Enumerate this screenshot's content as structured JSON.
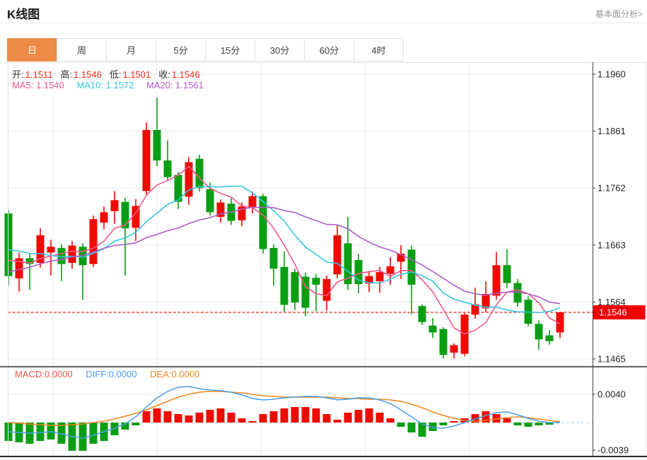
{
  "page": {
    "title": "K线图",
    "fundamental_link": "基本面分析>"
  },
  "tabs": [
    {
      "label": "日",
      "active": true
    },
    {
      "label": "周",
      "active": false
    },
    {
      "label": "月",
      "active": false
    },
    {
      "label": "5分",
      "active": false
    },
    {
      "label": "15分",
      "active": false
    },
    {
      "label": "30分",
      "active": false
    },
    {
      "label": "60分",
      "active": false
    },
    {
      "label": "4时",
      "active": false
    }
  ],
  "kline_legend": {
    "open_label": "开:",
    "open_value": "1.1511",
    "high_label": "高:",
    "high_value": "1.1546",
    "low_label": "低:",
    "low_value": "1.1501",
    "close_label": "收:",
    "close_value": "1.1546",
    "ma5_label": "MA5:",
    "ma5_value": "1.1540",
    "ma10_label": "MA10:",
    "ma10_value": "1.1572",
    "ma20_label": "MA20:",
    "ma20_value": "1.1561"
  },
  "macd_legend": {
    "macd_label": "MACD:",
    "macd_value": "0.0000",
    "diff_label": "DIFF:",
    "diff_value": "0.0000",
    "dea_label": "DEA:",
    "dea_value": "0.0000"
  },
  "colors": {
    "candle_up_red": "#ee0b00",
    "candle_down_green": "#0a9e14",
    "ma5": "#f2568a",
    "ma10": "#36c6e0",
    "ma20": "#b25bc8",
    "diff_line": "#4a9ce8",
    "dea_line": "#f0861c",
    "macd_text": "#f05452",
    "value_red": "#fa291c",
    "tab_active_bg": "#ed8a45",
    "badge_bg": "#ee0000",
    "grid": "#e8eef4",
    "border_light": "#e4e4e4",
    "border_dark": "#2b2b2b",
    "zero_dotted": "#aed9ec",
    "price_dashed": "#ff2211"
  },
  "chart_data": {
    "type": "candlestick+macd",
    "price_axis": {
      "tick_labels": [
        "1.1960",
        "1.1861",
        "1.1762",
        "1.1663",
        "1.1564",
        "1.1465"
      ],
      "ylim": [
        1.1465,
        1.196
      ],
      "current_price_label": "1.1546",
      "current_price": 1.1546,
      "grid": true
    },
    "macd_axis": {
      "tick_labels": [
        "0.0040",
        "-0.0039"
      ],
      "ylim": [
        -0.0039,
        0.004
      ]
    },
    "last_candle_ohlc": {
      "open": 1.1511,
      "high": 1.1546,
      "low": 1.1501,
      "close": 1.1546
    },
    "candles_ohlc": [
      [
        1.1718,
        1.1724,
        1.1593,
        1.1609
      ],
      [
        1.1605,
        1.165,
        1.1582,
        1.164
      ],
      [
        1.164,
        1.1648,
        1.1585,
        1.163
      ],
      [
        1.1632,
        1.1692,
        1.1624,
        1.168
      ],
      [
        1.165,
        1.1672,
        1.161,
        1.166
      ],
      [
        1.1658,
        1.1664,
        1.16,
        1.163
      ],
      [
        1.1632,
        1.167,
        1.1622,
        1.1662
      ],
      [
        1.166,
        1.1666,
        1.1568,
        1.1628
      ],
      [
        1.163,
        1.1714,
        1.1625,
        1.1708
      ],
      [
        1.1702,
        1.173,
        1.169,
        1.172
      ],
      [
        1.1722,
        1.1757,
        1.17,
        1.1741
      ],
      [
        1.1738,
        1.1745,
        1.161,
        1.1692
      ],
      [
        1.1693,
        1.1743,
        1.167,
        1.1731
      ],
      [
        1.1757,
        1.1876,
        1.175,
        1.1863
      ],
      [
        1.1863,
        1.1919,
        1.18,
        1.181
      ],
      [
        1.181,
        1.1845,
        1.1776,
        1.1781
      ],
      [
        1.1785,
        1.179,
        1.1726,
        1.1738
      ],
      [
        1.1747,
        1.1816,
        1.1733,
        1.1807
      ],
      [
        1.1813,
        1.182,
        1.1756,
        1.1762
      ],
      [
        1.176,
        1.1772,
        1.1714,
        1.172
      ],
      [
        1.1712,
        1.1742,
        1.1702,
        1.1737
      ],
      [
        1.1735,
        1.1744,
        1.1698,
        1.1705
      ],
      [
        1.1706,
        1.1737,
        1.1696,
        1.173
      ],
      [
        1.1728,
        1.1756,
        1.1718,
        1.1748
      ],
      [
        1.1748,
        1.1752,
        1.1648,
        1.1656
      ],
      [
        1.1658,
        1.1664,
        1.1592,
        1.1622
      ],
      [
        1.1625,
        1.1652,
        1.1547,
        1.1559
      ],
      [
        1.1616,
        1.1622,
        1.155,
        1.1563
      ],
      [
        1.1608,
        1.1615,
        1.1539,
        1.1554
      ],
      [
        1.1606,
        1.1612,
        1.1548,
        1.1594
      ],
      [
        1.1566,
        1.161,
        1.1549,
        1.1604
      ],
      [
        1.1612,
        1.1697,
        1.1605,
        1.168
      ],
      [
        1.1666,
        1.1712,
        1.1585,
        1.1595
      ],
      [
        1.1637,
        1.1648,
        1.1579,
        1.1595
      ],
      [
        1.1596,
        1.1618,
        1.1581,
        1.1609
      ],
      [
        1.16,
        1.1625,
        1.158,
        1.1616
      ],
      [
        1.1613,
        1.1642,
        1.1594,
        1.1626
      ],
      [
        1.1634,
        1.1663,
        1.1604,
        1.1648
      ],
      [
        1.1655,
        1.1662,
        1.1543,
        1.1594
      ],
      [
        1.1557,
        1.156,
        1.1524,
        1.1529
      ],
      [
        1.1523,
        1.1536,
        1.1501,
        1.1511
      ],
      [
        1.1517,
        1.152,
        1.1466,
        1.1472
      ],
      [
        1.1476,
        1.1492,
        1.1466,
        1.1489
      ],
      [
        1.1474,
        1.1545,
        1.147,
        1.1542
      ],
      [
        1.1542,
        1.1589,
        1.1535,
        1.156
      ],
      [
        1.1553,
        1.16,
        1.1546,
        1.1578
      ],
      [
        1.1575,
        1.1651,
        1.1568,
        1.1628
      ],
      [
        1.1628,
        1.1656,
        1.1588,
        1.1597
      ],
      [
        1.1597,
        1.1604,
        1.1556,
        1.1563
      ],
      [
        1.1568,
        1.1574,
        1.1522,
        1.1526
      ],
      [
        1.1526,
        1.1532,
        1.1481,
        1.1499
      ],
      [
        1.1506,
        1.1515,
        1.149,
        1.1496
      ],
      [
        1.1511,
        1.1546,
        1.1501,
        1.1546
      ]
    ],
    "ma_prior_closes_seed": [
      1.154,
      1.1548,
      1.1555,
      1.156,
      1.1565,
      1.157,
      1.1575,
      1.158,
      1.1585,
      1.1592,
      1.164,
      1.166,
      1.1675,
      1.1682,
      1.1693,
      1.1655,
      1.165,
      1.1645,
      1.1641,
      1.1638
    ],
    "ma_periods": [
      5,
      10,
      20
    ],
    "macd": {
      "bars": [
        -0.0026,
        -0.0028,
        -0.003,
        -0.0026,
        -0.0024,
        -0.003,
        -0.004,
        -0.004,
        -0.003,
        -0.0026,
        -0.0018,
        -0.001,
        -0.0004,
        0.0016,
        0.002,
        0.0016,
        0.0012,
        0.001,
        0.0014,
        0.0018,
        0.002,
        0.0014,
        0.0006,
        0.0002,
        0.0012,
        0.0016,
        0.002,
        0.0022,
        0.0022,
        0.002,
        0.0012,
        0.0004,
        0.0014,
        0.0018,
        0.002,
        0.0014,
        0.0006,
        -0.0006,
        -0.0014,
        -0.002,
        -0.0012,
        -0.0004,
        0.0002,
        0.0006,
        0.0012,
        0.0016,
        0.0012,
        0.0006,
        -0.0004,
        -0.0006,
        -0.0004,
        -0.0003,
        0.0
      ],
      "diff": [
        -0.0013,
        -0.0014,
        -0.0015,
        -0.0014,
        -0.0013,
        -0.0016,
        -0.002,
        -0.0022,
        -0.0018,
        -0.0013,
        -0.0008,
        -0.0002,
        0.0008,
        0.0022,
        0.0035,
        0.0044,
        0.005,
        0.0051,
        0.0048,
        0.0046,
        0.0045,
        0.0043,
        0.0039,
        0.0034,
        0.0032,
        0.0033,
        0.0035,
        0.0036,
        0.0037,
        0.0037,
        0.0035,
        0.0032,
        0.0033,
        0.0035,
        0.0035,
        0.0032,
        0.0027,
        0.0018,
        0.0008,
        -0.0002,
        -0.0007,
        -0.0008,
        -0.0005,
        0.0,
        0.0005,
        0.001,
        0.0014,
        0.0015,
        0.0011,
        0.0006,
        0.0002,
        0.0,
        0.0
      ],
      "dea": [
        0.0,
        -0.0001,
        -0.0002,
        -0.0003,
        -0.0004,
        -0.0004,
        -0.0003,
        -0.0002,
        0.0,
        0.0002,
        0.0005,
        0.0009,
        0.0013,
        0.0018,
        0.0024,
        0.003,
        0.0036,
        0.004,
        0.0043,
        0.0044,
        0.0044,
        0.0043,
        0.0042,
        0.004,
        0.0038,
        0.0037,
        0.0036,
        0.0036,
        0.0036,
        0.0036,
        0.0036,
        0.0035,
        0.0034,
        0.0034,
        0.0033,
        0.0033,
        0.0032,
        0.003,
        0.0026,
        0.0021,
        0.0015,
        0.001,
        0.0006,
        0.0003,
        0.0002,
        0.0003,
        0.0005,
        0.0007,
        0.0008,
        0.0007,
        0.0005,
        0.0003,
        0.0001
      ]
    }
  }
}
